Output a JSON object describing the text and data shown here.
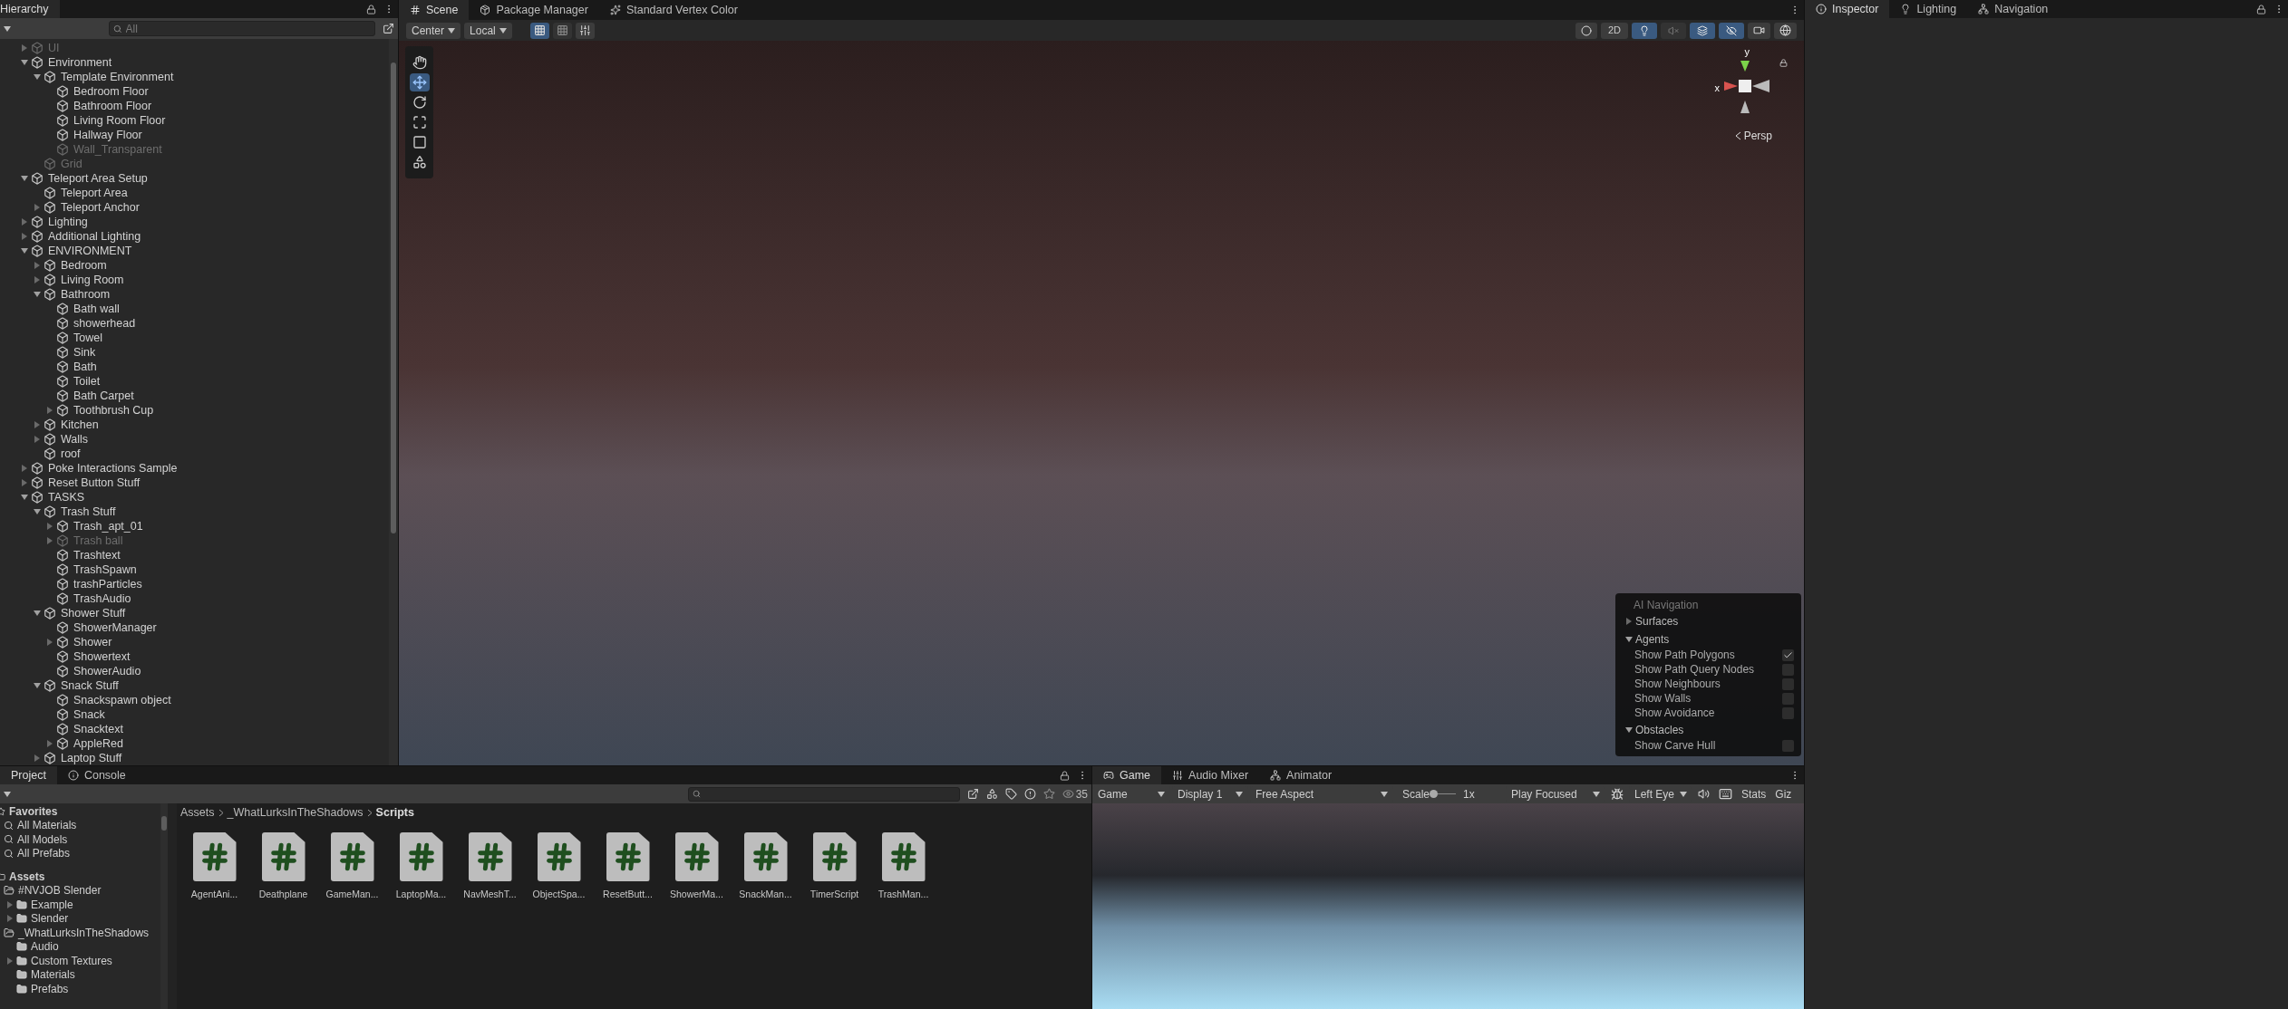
{
  "hierarchy": {
    "title": "Hierarchy",
    "search": {
      "placeholder": "All"
    },
    "items": [
      {
        "label": "UI",
        "expanded": false,
        "disabled": true
      },
      {
        "label": "Environment",
        "expanded": true,
        "disabled": false,
        "children": [
          {
            "label": "Template Environment",
            "expanded": true,
            "disabled": false,
            "children": [
              {
                "label": "Bedroom Floor",
                "disabled": false
              },
              {
                "label": "Bathroom Floor",
                "disabled": false
              },
              {
                "label": "Living Room Floor",
                "disabled": false
              },
              {
                "label": "Hallway Floor",
                "disabled": false
              },
              {
                "label": "Wall_Transparent",
                "disabled": true
              }
            ]
          },
          {
            "label": "Grid",
            "disabled": true
          }
        ]
      },
      {
        "label": "Teleport Area Setup",
        "expanded": true,
        "disabled": false,
        "children": [
          {
            "label": "Teleport Area",
            "disabled": false
          },
          {
            "label": "Teleport Anchor",
            "expanded": false,
            "disabled": false
          }
        ]
      },
      {
        "label": "Lighting",
        "expanded": false,
        "disabled": false
      },
      {
        "label": "Additional Lighting",
        "expanded": false,
        "disabled": false
      },
      {
        "label": "ENVIRONMENT",
        "expanded": true,
        "disabled": false,
        "children": [
          {
            "label": "Bedroom",
            "expanded": false,
            "disabled": false
          },
          {
            "label": "Living Room",
            "expanded": false,
            "disabled": false
          },
          {
            "label": "Bathroom",
            "expanded": true,
            "disabled": false,
            "children": [
              {
                "label": "Bath wall",
                "disabled": false
              },
              {
                "label": "showerhead",
                "disabled": false
              },
              {
                "label": "Towel",
                "disabled": false
              },
              {
                "label": "Sink",
                "disabled": false
              },
              {
                "label": "Bath",
                "disabled": false
              },
              {
                "label": "Toilet",
                "disabled": false
              },
              {
                "label": "Bath Carpet",
                "disabled": false
              },
              {
                "label": "Toothbrush Cup",
                "expanded": false,
                "disabled": false
              }
            ]
          },
          {
            "label": "Kitchen",
            "expanded": false,
            "disabled": false
          },
          {
            "label": "Walls",
            "expanded": false,
            "disabled": false
          },
          {
            "label": "roof",
            "disabled": false
          }
        ]
      },
      {
        "label": "Poke Interactions Sample",
        "expanded": false,
        "disabled": false
      },
      {
        "label": "Reset Button Stuff",
        "expanded": false,
        "disabled": false
      },
      {
        "label": "TASKS",
        "expanded": true,
        "disabled": false,
        "children": [
          {
            "label": "Trash Stuff",
            "expanded": true,
            "disabled": false,
            "children": [
              {
                "label": "Trash_apt_01",
                "expanded": false,
                "disabled": false
              },
              {
                "label": "Trash ball",
                "expanded": false,
                "disabled": true
              },
              {
                "label": "Trashtext",
                "disabled": false
              },
              {
                "label": "TrashSpawn",
                "disabled": false
              },
              {
                "label": "trashParticles",
                "disabled": false
              },
              {
                "label": "TrashAudio",
                "disabled": false
              }
            ]
          },
          {
            "label": "Shower Stuff",
            "expanded": true,
            "disabled": false,
            "children": [
              {
                "label": "ShowerManager",
                "disabled": false
              },
              {
                "label": "Shower",
                "expanded": false,
                "disabled": false
              },
              {
                "label": "Showertext",
                "disabled": false
              },
              {
                "label": "ShowerAudio",
                "disabled": false
              }
            ]
          },
          {
            "label": "Snack Stuff",
            "expanded": true,
            "disabled": false,
            "children": [
              {
                "label": "Snackspawn object",
                "disabled": false
              },
              {
                "label": "Snack",
                "disabled": false
              },
              {
                "label": "Snacktext",
                "disabled": false
              },
              {
                "label": "AppleRed",
                "expanded": false,
                "disabled": false
              }
            ]
          },
          {
            "label": "Laptop Stuff",
            "expanded": false,
            "disabled": false
          }
        ]
      }
    ]
  },
  "scene": {
    "tabs": [
      {
        "label": "Scene",
        "selected": true
      },
      {
        "label": "Package Manager",
        "selected": false
      },
      {
        "label": "Standard Vertex Color",
        "selected": false
      }
    ],
    "pivot": "Center",
    "space": "Local",
    "mode_2d": "2D",
    "toggles": [
      {
        "kind": "light",
        "on": true
      },
      {
        "kind": "audio",
        "on": false
      },
      {
        "kind": "effects",
        "on": true
      },
      {
        "kind": "visibility",
        "on": true
      }
    ],
    "projection": "Persp",
    "axis_x": "x",
    "axis_y": "y",
    "ai_navigation": {
      "title": "AI Navigation",
      "sections": [
        {
          "label": "Surfaces",
          "expanded": false
        },
        {
          "label": "Agents",
          "expanded": true,
          "options": [
            {
              "label": "Show Path Polygons",
              "checked": true
            },
            {
              "label": "Show Path Query Nodes",
              "checked": false
            },
            {
              "label": "Show Neighbours",
              "checked": false
            },
            {
              "label": "Show Walls",
              "checked": false
            },
            {
              "label": "Show Avoidance",
              "checked": false
            }
          ]
        },
        {
          "label": "Obstacles",
          "expanded": true,
          "options": [
            {
              "label": "Show Carve Hull",
              "checked": false
            }
          ]
        }
      ]
    }
  },
  "inspector": {
    "tabs": [
      {
        "label": "Inspector",
        "selected": true
      },
      {
        "label": "Lighting",
        "selected": false
      },
      {
        "label": "Navigation",
        "selected": false
      }
    ]
  },
  "project": {
    "tabs": [
      {
        "label": "Project",
        "selected": true
      },
      {
        "label": "Console",
        "selected": false
      }
    ],
    "hidden_count": "35",
    "favorites": {
      "label": "Favorites",
      "items": [
        "All Materials",
        "All Models",
        "All Prefabs"
      ]
    },
    "assets": {
      "label": "Assets",
      "children": [
        {
          "label": "#NVJOB Slender",
          "children": [
            {
              "label": "Example",
              "expandable": true
            },
            {
              "label": "Slender",
              "expandable": true
            }
          ]
        },
        {
          "label": "_WhatLurksInTheShadows",
          "children": [
            {
              "label": "Audio",
              "expandable": false
            },
            {
              "label": "Custom Textures",
              "expandable": true
            },
            {
              "label": "Materials",
              "expandable": false
            },
            {
              "label": "Prefabs",
              "expandable": false
            }
          ]
        }
      ]
    },
    "breadcrumb": [
      "Assets",
      "_WhatLurksInTheShadows",
      "Scripts"
    ],
    "files": [
      "AgentAni...",
      "Deathplane",
      "GameMan...",
      "LaptopMa...",
      "NavMeshT...",
      "ObjectSpa...",
      "ResetButt...",
      "ShowerMa...",
      "SnackMan...",
      "TimerScript",
      "TrashMan..."
    ]
  },
  "game": {
    "tabs": [
      {
        "label": "Game",
        "selected": true
      },
      {
        "label": "Audio Mixer",
        "selected": false
      },
      {
        "label": "Animator",
        "selected": false
      }
    ],
    "view": "Game",
    "display": "Display 1",
    "aspect": "Free Aspect",
    "scale_label": "Scale",
    "scale": {
      "level": 0
    },
    "scale_value": "1x",
    "play_mode": "Play Focused",
    "eye": "Left Eye",
    "stats": "Stats",
    "gizmos": "Giz"
  }
}
